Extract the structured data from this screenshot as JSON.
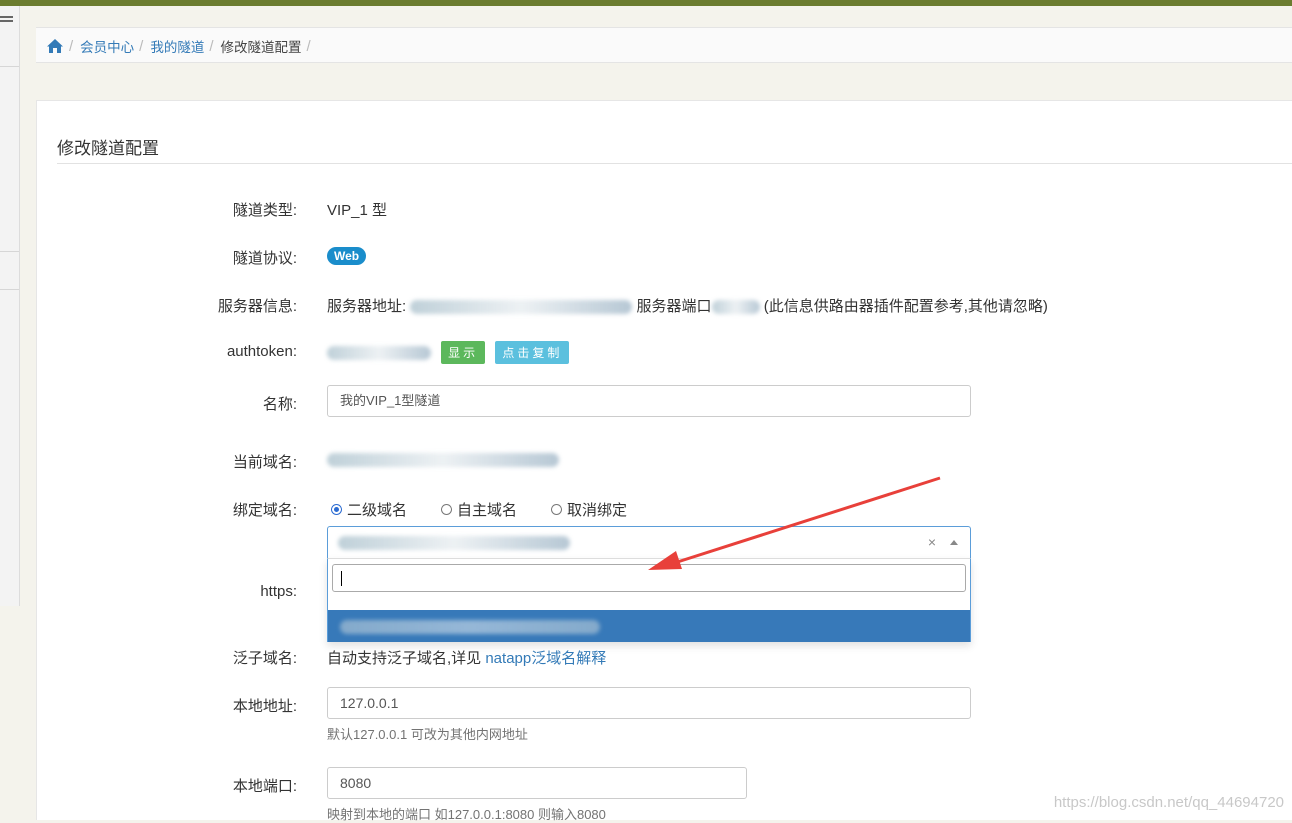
{
  "breadcrumb": {
    "items": [
      "会员中心",
      "我的隧道"
    ],
    "current": "修改隧道配置"
  },
  "page": {
    "title": "修改隧道配置"
  },
  "form": {
    "tunnel_type": {
      "label": "隧道类型:",
      "value": "VIP_1 型"
    },
    "protocol": {
      "label": "隧道协议:",
      "badge": "Web"
    },
    "server": {
      "label": "服务器信息:",
      "addr_prefix": "服务器地址:",
      "port_prefix": "服务器端口",
      "note": "(此信息供路由器插件配置参考,其他请忽略)"
    },
    "authtoken": {
      "label": "authtoken:",
      "show_button": "显示",
      "copy_button": "点击复制"
    },
    "name": {
      "label": "名称:",
      "value": "我的VIP_1型隧道"
    },
    "current_domain": {
      "label": "当前域名:"
    },
    "bind_domain": {
      "label": "绑定域名:",
      "options": [
        "二级域名",
        "自主域名",
        "取消绑定"
      ],
      "selected": "二级域名",
      "clear_symbol": "×"
    },
    "https": {
      "label": "https:"
    },
    "wildcard": {
      "label": "泛子域名:",
      "text": "自动支持泛子域名,详见 ",
      "link": "natapp泛域名解释"
    },
    "local_addr": {
      "label": "本地地址:",
      "value": "127.0.0.1",
      "help": "默认127.0.0.1 可改为其他内网地址"
    },
    "local_port": {
      "label": "本地端口:",
      "value": "8080",
      "help": "映射到本地的端口 如127.0.0.1:8080 则输入8080"
    }
  },
  "watermark": "https://blog.csdn.net/qq_44694720",
  "colors": {
    "accent": "#337ab7",
    "web_badge": "#1a8dcb",
    "show_btn": "#5cb85c",
    "copy_btn": "#5bc0de",
    "highlight": "#3779b9",
    "annotation_arrow": "#e8403a"
  }
}
